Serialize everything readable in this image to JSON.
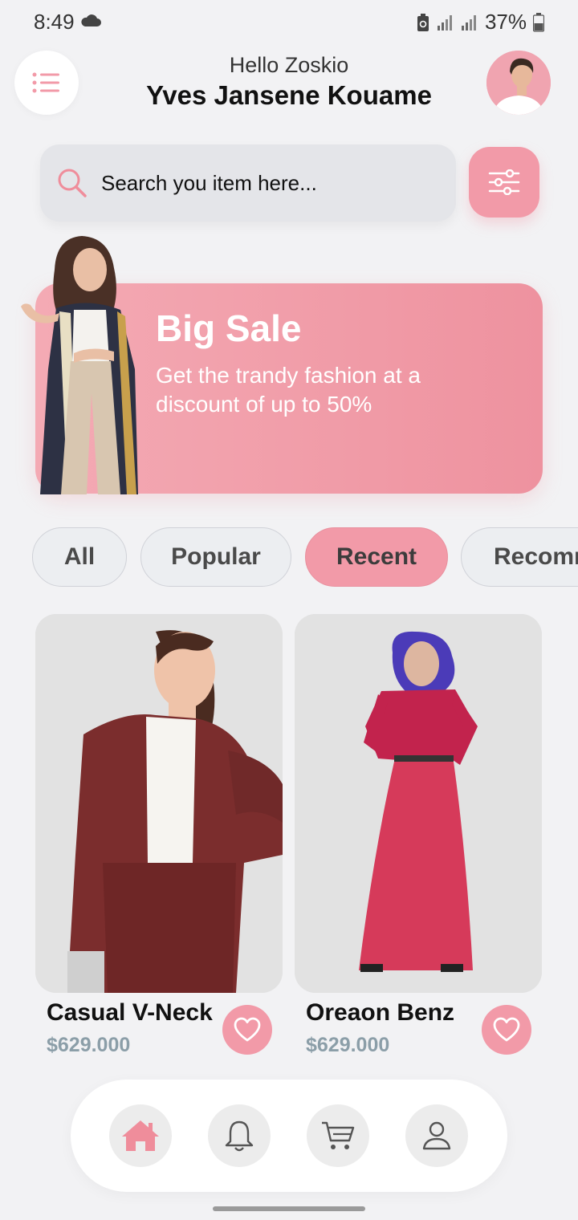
{
  "status_bar": {
    "time": "8:49",
    "battery": "37%"
  },
  "header": {
    "greeting": "Hello Zoskio",
    "username": "Yves Jansene Kouame"
  },
  "search": {
    "placeholder": "Search you item here..."
  },
  "banner": {
    "title": "Big Sale",
    "subtitle": "Get the trandy fashion at a discount of up to 50%"
  },
  "categories": [
    {
      "label": "All",
      "active": false
    },
    {
      "label": "Popular",
      "active": false
    },
    {
      "label": "Recent",
      "active": true
    },
    {
      "label": "Recomm",
      "active": false
    }
  ],
  "products": [
    {
      "name": "Casual V-Neck",
      "price": "$629.000"
    },
    {
      "name": "Oreaon Benz",
      "price": "$629.000"
    }
  ],
  "bottom_nav": [
    {
      "icon": "home-icon",
      "active": true
    },
    {
      "icon": "bell-icon",
      "active": false
    },
    {
      "icon": "cart-icon",
      "active": false
    },
    {
      "icon": "user-icon",
      "active": false
    }
  ],
  "colors": {
    "accent": "#f29aa8",
    "background": "#f2f2f4",
    "price": "#8b9ea8"
  }
}
